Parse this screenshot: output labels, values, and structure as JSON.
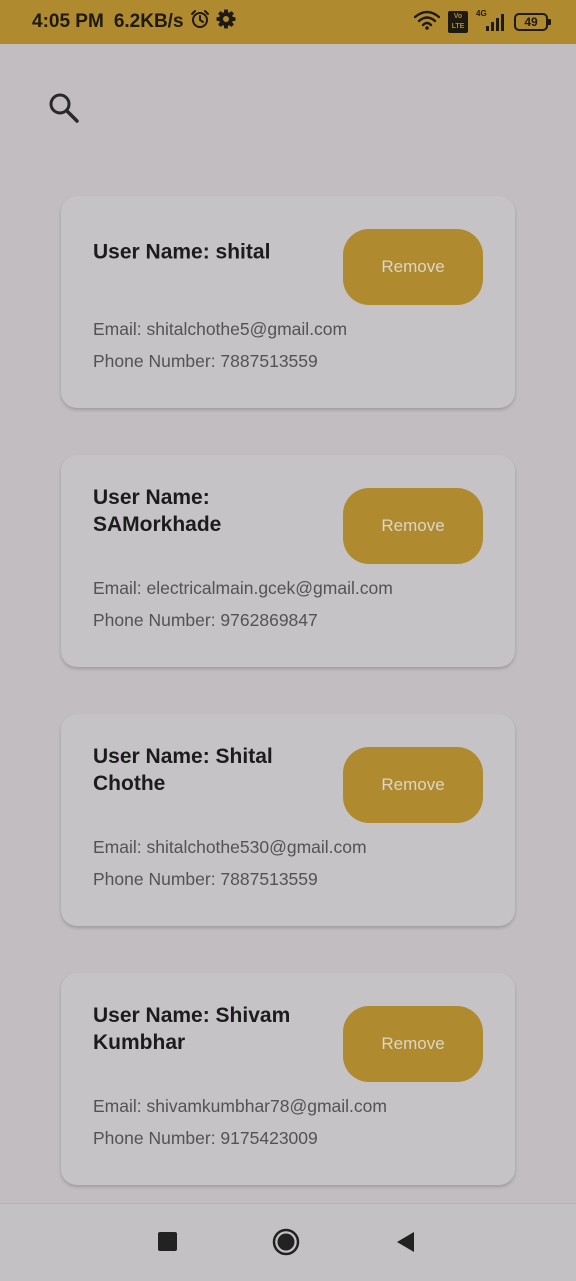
{
  "status_bar": {
    "time": "4:05 PM",
    "network_speed": "6.2KB/s",
    "volte_label": "Vo LTE",
    "network_type": "4G",
    "battery_level": "49",
    "icons": [
      "alarm-icon",
      "settings-icon",
      "wifi-icon",
      "volte-icon",
      "signal-icon",
      "battery-icon"
    ]
  },
  "toolbar": {
    "search_icon": "search-icon"
  },
  "users": [
    {
      "name": "User Name: shital",
      "email": "Email: shitalchothe5@gmail.com",
      "phone": "Phone Number: 7887513559",
      "action": "Remove"
    },
    {
      "name": "User Name: SAMorkhade",
      "email": "Email: electricalmain.gcek@gmail.com",
      "phone": "Phone Number: 9762869847",
      "action": "Remove"
    },
    {
      "name": "User Name: Shital Chothe",
      "email": "Email: shitalchothe530@gmail.com",
      "phone": "Phone Number: 7887513559",
      "action": "Remove"
    },
    {
      "name": "User Name: Shivam Kumbhar",
      "email": "Email: shivamkumbhar78@gmail.com",
      "phone": "Phone Number: 9175423009",
      "action": "Remove"
    }
  ],
  "nav_bar": {
    "icons": [
      "recent-apps-icon",
      "home-icon",
      "back-icon"
    ]
  },
  "colors": {
    "accent": "#b08a2e",
    "background": "#c1bdc1",
    "card": "#c5c3c5",
    "text_primary": "#1d1c1d",
    "text_secondary": "#545254"
  }
}
